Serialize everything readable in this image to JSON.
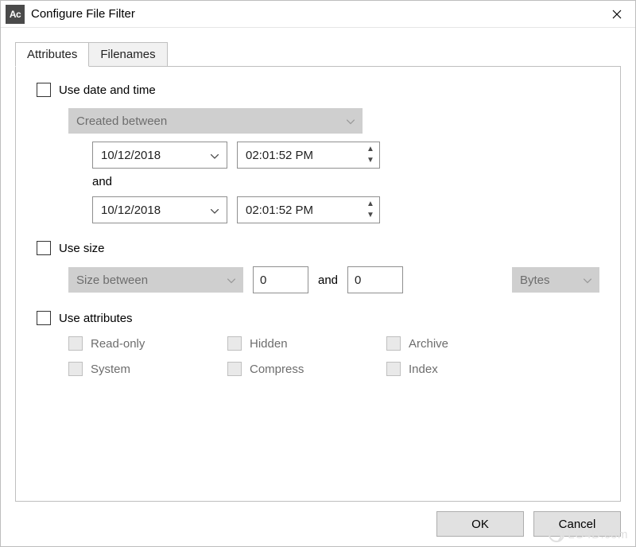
{
  "window": {
    "app_icon_text": "Ac",
    "title": "Configure File Filter"
  },
  "tabs": {
    "attributes": "Attributes",
    "filenames": "Filenames"
  },
  "date": {
    "use_label": "Use date and time",
    "use_checked": false,
    "mode_label": "Created between",
    "from_date": "10/12/2018",
    "from_time": "02:01:52  PM",
    "and_label": "and",
    "to_date": "10/12/2018",
    "to_time": "02:01:52  PM"
  },
  "size": {
    "use_label": "Use size",
    "use_checked": false,
    "mode_label": "Size between",
    "from": "0",
    "and_label": "and",
    "to": "0",
    "unit": "Bytes"
  },
  "attrs": {
    "use_label": "Use attributes",
    "use_checked": false,
    "readonly": "Read-only",
    "hidden": "Hidden",
    "archive": "Archive",
    "system": "System",
    "compress": "Compress",
    "index": "Index"
  },
  "buttons": {
    "ok": "OK",
    "cancel": "Cancel"
  },
  "watermark": "LO4D.com"
}
